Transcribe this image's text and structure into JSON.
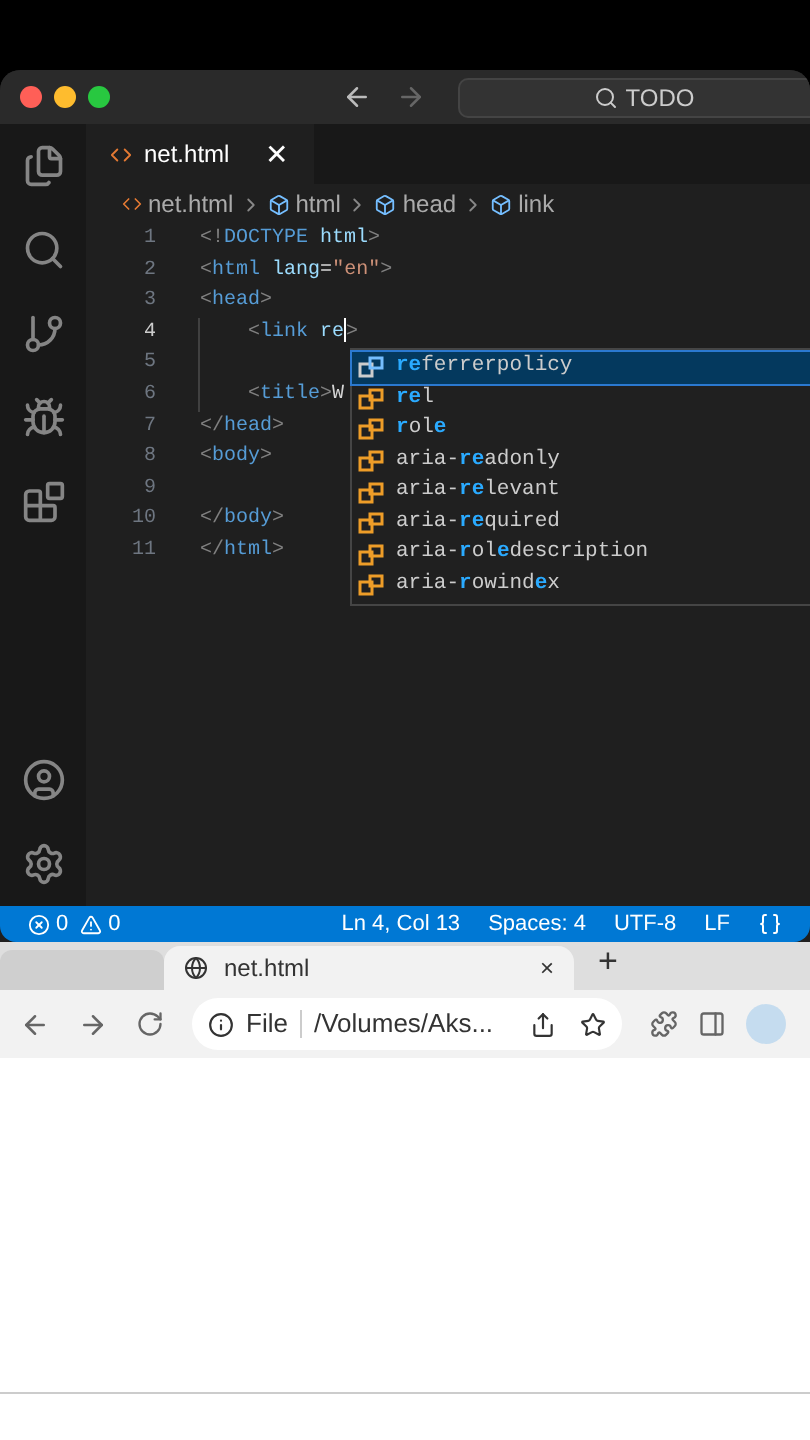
{
  "editor": {
    "command_center": {
      "text": "TODO"
    },
    "tabs": [
      {
        "label": "net.html",
        "selected": true,
        "close": "✕"
      }
    ],
    "breadcrumbs": [
      "net.html",
      "html",
      "head",
      "link"
    ],
    "lines": [
      {
        "number": "1",
        "active": false,
        "tokens": [
          {
            "text": "<!",
            "kind": "punct"
          },
          {
            "text": "DOCTYPE",
            "kind": "tag"
          },
          {
            "text": " html",
            "kind": "attr"
          },
          {
            "text": ">",
            "kind": "punct"
          }
        ]
      },
      {
        "number": "2",
        "active": false,
        "tokens": [
          {
            "text": "<",
            "kind": "punct"
          },
          {
            "text": "html",
            "kind": "tag"
          },
          {
            "text": " lang",
            "kind": "attr"
          },
          {
            "text": "=",
            "kind": "text"
          },
          {
            "text": "\"en\"",
            "kind": "str"
          },
          {
            "text": ">",
            "kind": "punct"
          }
        ]
      },
      {
        "number": "3",
        "active": false,
        "tokens": [
          {
            "text": "<",
            "kind": "punct"
          },
          {
            "text": "head",
            "kind": "tag"
          },
          {
            "text": ">",
            "kind": "punct"
          }
        ]
      },
      {
        "number": "4",
        "active": true,
        "indent": true,
        "tokens": [
          {
            "text": "    <",
            "kind": "punct"
          },
          {
            "text": "link",
            "kind": "tag"
          },
          {
            "text": " re",
            "kind": "attr"
          },
          {
            "text": ">",
            "kind": "punct",
            "cursor_before": true
          }
        ]
      },
      {
        "number": "5",
        "active": false,
        "indent": true
      },
      {
        "number": "6",
        "active": false,
        "indent": true,
        "tokens": [
          {
            "text": "    <",
            "kind": "punct"
          },
          {
            "text": "title",
            "kind": "tag"
          },
          {
            "text": ">",
            "kind": "punct"
          },
          {
            "text": "W",
            "kind": "text"
          }
        ]
      },
      {
        "number": "7",
        "active": false,
        "tokens": [
          {
            "text": "</",
            "kind": "punct"
          },
          {
            "text": "head",
            "kind": "tag"
          },
          {
            "text": ">",
            "kind": "punct"
          }
        ]
      },
      {
        "number": "8",
        "active": false,
        "tokens": [
          {
            "text": "<",
            "kind": "punct"
          },
          {
            "text": "body",
            "kind": "tag"
          },
          {
            "text": ">",
            "kind": "punct"
          }
        ]
      },
      {
        "number": "9",
        "active": false
      },
      {
        "number": "10",
        "active": false,
        "tokens": [
          {
            "text": "</",
            "kind": "punct"
          },
          {
            "text": "body",
            "kind": "tag"
          },
          {
            "text": ">",
            "kind": "punct"
          }
        ]
      },
      {
        "number": "11",
        "active": false,
        "tokens": [
          {
            "text": "</",
            "kind": "punct"
          },
          {
            "text": "html",
            "kind": "tag"
          },
          {
            "text": ">",
            "kind": "punct"
          }
        ]
      }
    ],
    "suggestions": [
      {
        "selected": true,
        "parts": [
          {
            "text": "re",
            "match": true
          },
          {
            "text": "ferrerpolicy",
            "match": false
          }
        ]
      },
      {
        "selected": false,
        "parts": [
          {
            "text": "re",
            "match": true
          },
          {
            "text": "l",
            "match": false
          }
        ]
      },
      {
        "selected": false,
        "parts": [
          {
            "text": "r",
            "match": true
          },
          {
            "text": "ol",
            "match": false
          },
          {
            "text": "e",
            "match": true
          }
        ]
      },
      {
        "selected": false,
        "parts": [
          {
            "text": "aria-",
            "match": false
          },
          {
            "text": "re",
            "match": true
          },
          {
            "text": "adonly",
            "match": false
          }
        ]
      },
      {
        "selected": false,
        "parts": [
          {
            "text": "aria-",
            "match": false
          },
          {
            "text": "re",
            "match": true
          },
          {
            "text": "levant",
            "match": false
          }
        ]
      },
      {
        "selected": false,
        "parts": [
          {
            "text": "aria-",
            "match": false
          },
          {
            "text": "re",
            "match": true
          },
          {
            "text": "quired",
            "match": false
          }
        ]
      },
      {
        "selected": false,
        "parts": [
          {
            "text": "aria-",
            "match": false
          },
          {
            "text": "r",
            "match": true
          },
          {
            "text": "ol",
            "match": false
          },
          {
            "text": "e",
            "match": true
          },
          {
            "text": "description",
            "match": false
          }
        ]
      },
      {
        "selected": false,
        "parts": [
          {
            "text": "aria-",
            "match": false
          },
          {
            "text": "r",
            "match": true
          },
          {
            "text": "owind",
            "match": false
          },
          {
            "text": "e",
            "match": true
          },
          {
            "text": "x",
            "match": false
          }
        ]
      }
    ],
    "status_bar": {
      "errors": "0",
      "warnings": "0",
      "items": [
        "Ln 4, Col 13",
        "Spaces: 4",
        "UTF-8",
        "LF"
      ]
    }
  },
  "browser": {
    "tab": {
      "title": "net.html",
      "close": "×"
    },
    "new_tab": "+",
    "address": {
      "scheme": "File",
      "path": "/Volumes/Aks..."
    }
  }
}
